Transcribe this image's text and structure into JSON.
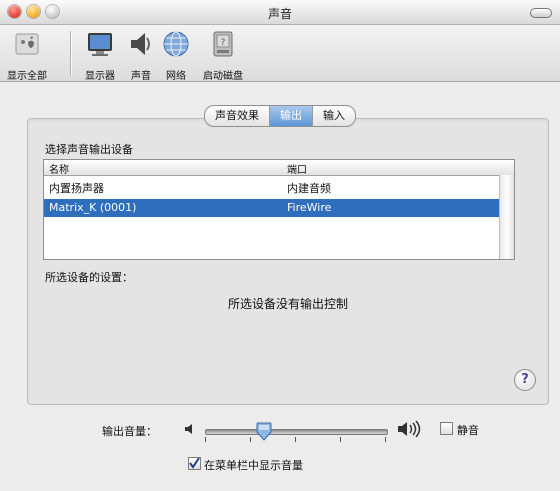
{
  "window": {
    "title": "声音"
  },
  "toolbar": {
    "items": [
      {
        "label": "显示全部",
        "icon": "show-all-icon"
      },
      {
        "label": "显示器",
        "icon": "display-icon"
      },
      {
        "label": "声音",
        "icon": "sound-icon"
      },
      {
        "label": "网络",
        "icon": "network-icon"
      },
      {
        "label": "启动磁盘",
        "icon": "startup-disk-icon"
      }
    ]
  },
  "tabs": [
    {
      "label": "声音效果",
      "selected": false
    },
    {
      "label": "输出",
      "selected": true
    },
    {
      "label": "输入",
      "selected": false
    }
  ],
  "output": {
    "choose_label": "选择声音输出设备",
    "columns": [
      "名称",
      "端口"
    ],
    "devices": [
      {
        "name": "内置扬声器",
        "port": "内建音频",
        "selected": false
      },
      {
        "name": "Matrix_K (0001)",
        "port": "FireWire",
        "selected": true
      }
    ],
    "settings_label": "所选设备的设置：",
    "no_controls": "所选设备没有输出控制",
    "help": "?"
  },
  "volume": {
    "label": "输出音量：",
    "level": 0.3,
    "mute_label": "静音",
    "mute_checked": false,
    "menu_bar_label": "在菜单栏中显示音量",
    "menu_bar_checked": true
  },
  "colors": {
    "selection": "#2f6dbd",
    "tab_selected": "#5d95d6"
  }
}
